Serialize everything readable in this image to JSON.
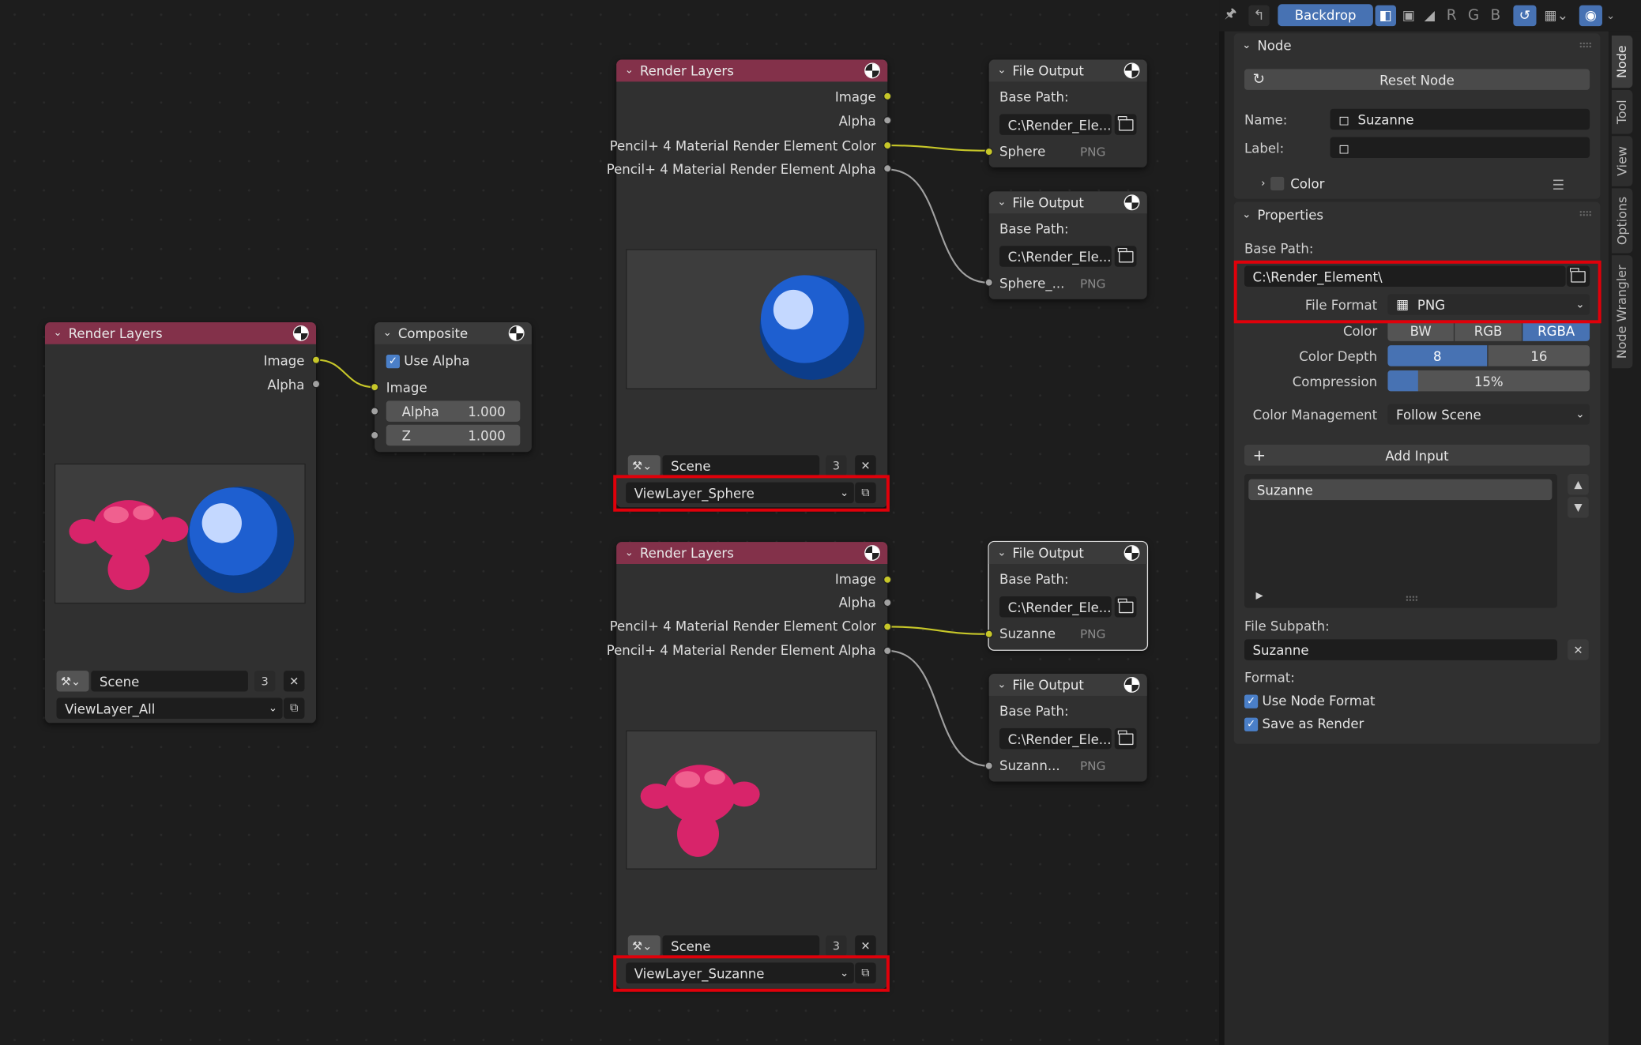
{
  "header": {
    "backdrop_label": "Backdrop",
    "channels": [
      "R",
      "G",
      "B"
    ]
  },
  "nodes": {
    "rl_all": {
      "title": "Render Layers",
      "outputs": [
        "Image",
        "Alpha"
      ],
      "scene": "Scene",
      "scene_users": "3",
      "view_layer": "ViewLayer_All"
    },
    "composite": {
      "title": "Composite",
      "use_alpha": "Use Alpha",
      "input_image": "Image",
      "alpha_label": "Alpha",
      "alpha_value": "1.000",
      "z_label": "Z",
      "z_value": "1.000"
    },
    "rl_sphere": {
      "title": "Render Layers",
      "outputs": [
        "Image",
        "Alpha",
        "Pencil+ 4 Material Render Element Color",
        "Pencil+ 4 Material Render Element Alpha"
      ],
      "scene": "Scene",
      "scene_users": "3",
      "view_layer": "ViewLayer_Sphere"
    },
    "rl_suzanne": {
      "title": "Render Layers",
      "outputs": [
        "Image",
        "Alpha",
        "Pencil+ 4 Material Render Element Color",
        "Pencil+ 4 Material Render Element Alpha"
      ],
      "scene": "Scene",
      "scene_users": "3",
      "view_layer": "ViewLayer_Suzanne"
    },
    "fo1": {
      "title": "File Output",
      "base_path_label": "Base Path:",
      "base_path": "C:\\Render_Ele...",
      "input": "Sphere",
      "format": "PNG"
    },
    "fo2": {
      "title": "File Output",
      "base_path_label": "Base Path:",
      "base_path": "C:\\Render_Ele...",
      "input": "Sphere_...",
      "format": "PNG"
    },
    "fo3": {
      "title": "File Output",
      "base_path_label": "Base Path:",
      "base_path": "C:\\Render_Ele...",
      "input": "Suzanne",
      "format": "PNG"
    },
    "fo4": {
      "title": "File Output",
      "base_path_label": "Base Path:",
      "base_path": "C:\\Render_Ele...",
      "input": "Suzann...",
      "format": "PNG"
    }
  },
  "sidebar": {
    "node_panel": {
      "title": "Node",
      "reset_button": "Reset Node",
      "name_label": "Name:",
      "name_value": "Suzanne",
      "label_label": "Label:",
      "label_value": "",
      "color_label": "Color"
    },
    "properties_panel": {
      "title": "Properties",
      "base_path_label": "Base Path:",
      "base_path_value": "C:\\Render_Element\\",
      "file_format_label": "File Format",
      "file_format_value": "PNG",
      "color_label": "Color",
      "color_options": [
        "BW",
        "RGB",
        "RGBA"
      ],
      "color_selected": "RGBA",
      "color_depth_label": "Color Depth",
      "color_depth_options": [
        "8",
        "16"
      ],
      "color_depth_selected": "8",
      "compression_label": "Compression",
      "compression_value": "15%",
      "compression_fraction": 0.15,
      "color_management_label": "Color Management",
      "color_management_value": "Follow Scene",
      "add_input_label": "Add Input",
      "inputs_list": [
        "Suzanne"
      ],
      "file_subpath_label": "File Subpath:",
      "file_subpath_value": "Suzanne",
      "format_label": "Format:",
      "use_node_format_label": "Use Node Format",
      "save_as_render_label": "Save as Render"
    }
  },
  "tabs": [
    "Node",
    "Tool",
    "View",
    "Options",
    "Node Wrangler"
  ],
  "colors": {
    "accent": "#4772b3",
    "render_layers_header": "#83314a",
    "highlight": "#e0000a",
    "socket_image": "#c7c729",
    "socket_value": "#a1a1a1"
  }
}
